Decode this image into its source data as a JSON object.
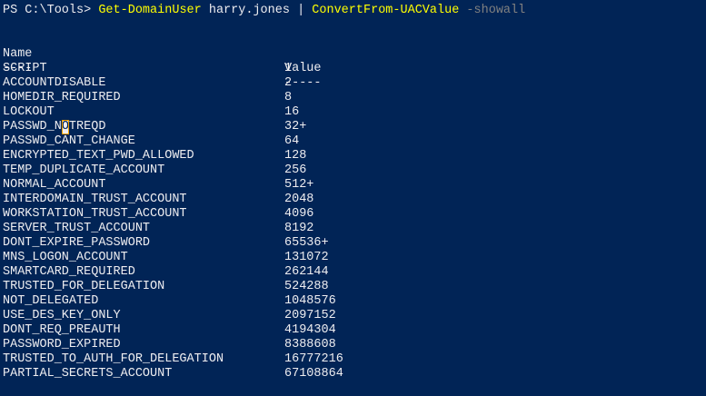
{
  "window": {
    "background": "#012456",
    "foreground": "#eeedf0",
    "command_color": "#ffff00",
    "parameter_color": "#808080"
  },
  "prompt": {
    "path_prompt": "PS C:\\Tools> ",
    "cmd1": "Get-DomainUser",
    "arg1": " harry.jones | ",
    "cmd2": "ConvertFrom-UACValue",
    "space": " ",
    "param": "-showall"
  },
  "table": {
    "headers": [
      "Name",
      "Value"
    ],
    "underlines": [
      "----",
      "-----"
    ],
    "rows": [
      {
        "name": "SCRIPT",
        "value": "1"
      },
      {
        "name": "ACCOUNTDISABLE",
        "value": "2"
      },
      {
        "name": "HOMEDIR_REQUIRED",
        "value": "8"
      },
      {
        "name": "LOCKOUT",
        "value": "16"
      },
      {
        "name": "PASSWD_NOTREQD",
        "value": "32+"
      },
      {
        "name": "PASSWD_CANT_CHANGE",
        "value": "64"
      },
      {
        "name": "ENCRYPTED_TEXT_PWD_ALLOWED",
        "value": "128"
      },
      {
        "name": "TEMP_DUPLICATE_ACCOUNT",
        "value": "256"
      },
      {
        "name": "NORMAL_ACCOUNT",
        "value": "512+"
      },
      {
        "name": "INTERDOMAIN_TRUST_ACCOUNT",
        "value": "2048"
      },
      {
        "name": "WORKSTATION_TRUST_ACCOUNT",
        "value": "4096"
      },
      {
        "name": "SERVER_TRUST_ACCOUNT",
        "value": "8192"
      },
      {
        "name": "DONT_EXPIRE_PASSWORD",
        "value": "65536+"
      },
      {
        "name": "MNS_LOGON_ACCOUNT",
        "value": "131072"
      },
      {
        "name": "SMARTCARD_REQUIRED",
        "value": "262144"
      },
      {
        "name": "TRUSTED_FOR_DELEGATION",
        "value": "524288"
      },
      {
        "name": "NOT_DELEGATED",
        "value": "1048576"
      },
      {
        "name": "USE_DES_KEY_ONLY",
        "value": "2097152"
      },
      {
        "name": "DONT_REQ_PREAUTH",
        "value": "4194304"
      },
      {
        "name": "PASSWORD_EXPIRED",
        "value": "8388608"
      },
      {
        "name": "TRUSTED_TO_AUTH_FOR_DELEGATION",
        "value": "16777216"
      },
      {
        "name": "PARTIAL_SECRETS_ACCOUNT",
        "value": "67108864"
      }
    ]
  }
}
